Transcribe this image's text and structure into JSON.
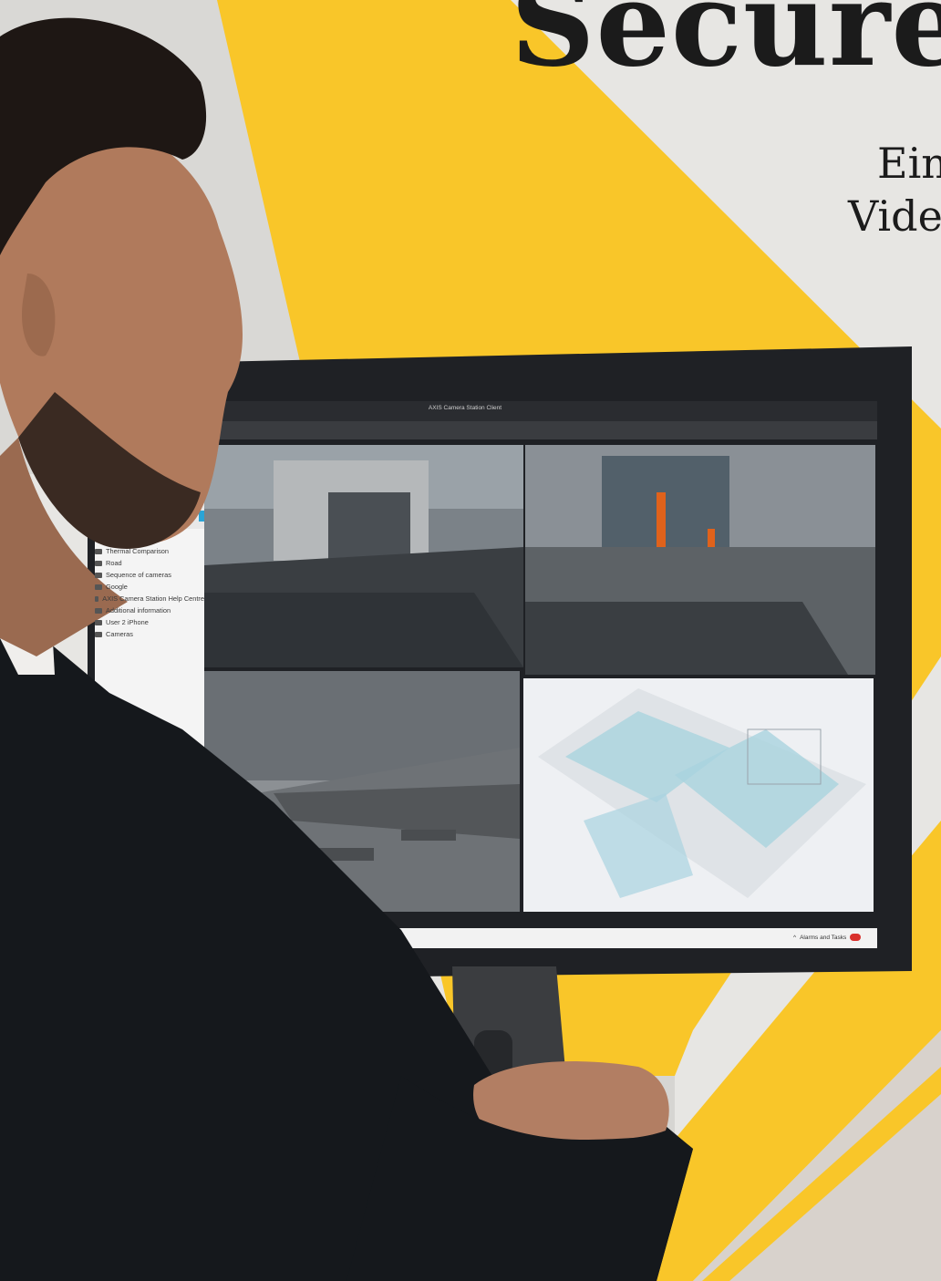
{
  "headline": "Secure",
  "subline_1": "Ein",
  "subline_2": "Vide",
  "window_title": "AXIS Camera Station Client",
  "side_panel": {
    "items": [
      {
        "label": "Thermal Comparison",
        "icon": "grid-icon"
      },
      {
        "label": "Road",
        "icon": "grid-icon"
      },
      {
        "label": "Sequence of cameras",
        "icon": "sequence-icon"
      },
      {
        "label": "Google",
        "icon": "globe-icon"
      },
      {
        "label": "AXIS Camera Station Help Centre",
        "icon": "globe-icon"
      },
      {
        "label": "Additional information",
        "icon": "folder-icon"
      },
      {
        "label": "User 2 iPhone",
        "icon": "user-icon"
      },
      {
        "label": "Cameras",
        "icon": "folder-icon"
      }
    ]
  },
  "alarm_bar": {
    "label": "Alarms and Tasks"
  },
  "colors": {
    "accent_yellow": "#f9c629",
    "headline_text": "#1b1b1b",
    "wall": "#e9e8e6",
    "jacket": "#16191d",
    "monitor": "#222428"
  }
}
